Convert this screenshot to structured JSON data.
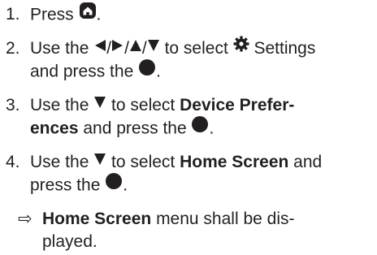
{
  "steps": [
    {
      "num": "1.",
      "lines": [
        {
          "a": "Press ",
          "icon": "home-icon",
          "b": "."
        }
      ]
    },
    {
      "num": "2.",
      "lines": [
        {
          "a": "Use the ",
          "icons": [
            "left-triangle-icon",
            "/",
            "right-triangle-icon",
            "/",
            "up-triangle-icon",
            "/",
            "down-triangle-icon"
          ],
          "b": " to select ",
          "gear": "gear-icon",
          "c": " Settings"
        },
        {
          "a": "and press the ",
          "icon": "ok-button-icon",
          "b": "."
        }
      ]
    },
    {
      "num": "3.",
      "lines": [
        {
          "a": "Use the ",
          "icon": "down-triangle-icon",
          "b": " to select ",
          "bold": "Device Prefer-"
        },
        {
          "bold": "ences",
          "a": " and press the ",
          "icon": "ok-button-icon",
          "b": "."
        }
      ]
    },
    {
      "num": "4.",
      "lines": [
        {
          "a": "Use the ",
          "icon": "down-triangle-icon",
          "b": " to select ",
          "bold": "Home Screen",
          "c": " and"
        },
        {
          "a": "press the ",
          "icon": "ok-button-icon",
          "b": "."
        }
      ]
    }
  ],
  "result": {
    "arrow": "⇨",
    "line1_bold": "Home Screen",
    "line1_rest": " menu shall be dis-",
    "line2": "played."
  },
  "colors": {
    "text": "#231f20"
  }
}
